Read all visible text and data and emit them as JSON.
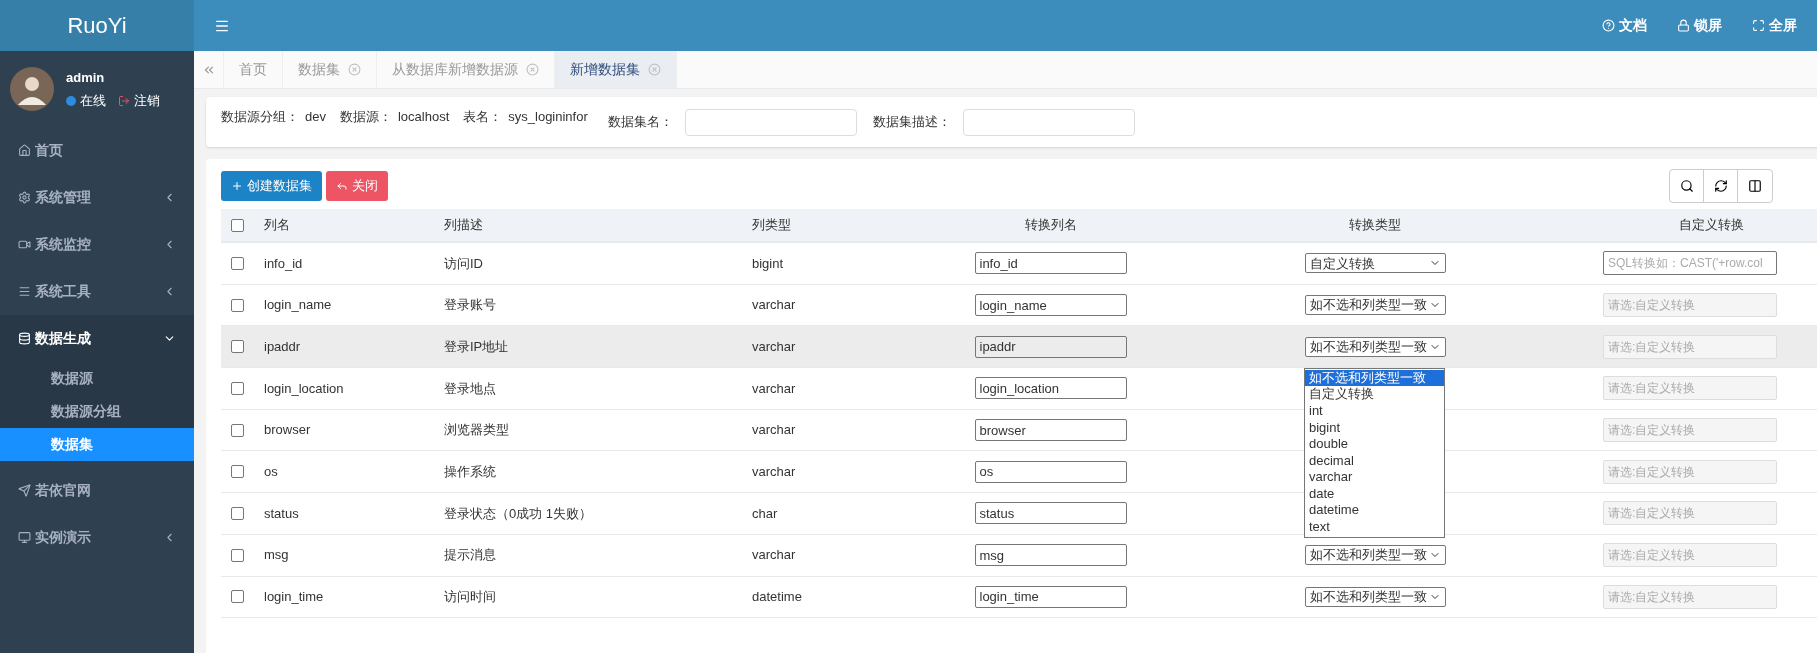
{
  "header": {
    "brand": "RuoYi",
    "actions": [
      {
        "label": "文档"
      },
      {
        "label": "锁屏"
      },
      {
        "label": "全屏"
      }
    ]
  },
  "user": {
    "name": "admin",
    "status": "在线",
    "logout": "注销"
  },
  "sidebar": {
    "items": [
      {
        "label": "首页",
        "kind": "link"
      },
      {
        "label": "系统管理",
        "kind": "group",
        "expanded": false
      },
      {
        "label": "系统监控",
        "kind": "group",
        "expanded": false
      },
      {
        "label": "系统工具",
        "kind": "group",
        "expanded": false
      },
      {
        "label": "数据生成",
        "kind": "group",
        "expanded": true,
        "children": [
          {
            "label": "数据源",
            "selected": false
          },
          {
            "label": "数据源分组",
            "selected": false
          },
          {
            "label": "数据集",
            "selected": true
          }
        ]
      },
      {
        "label": "若依官网",
        "kind": "link"
      },
      {
        "label": "实例演示",
        "kind": "group",
        "expanded": false
      }
    ]
  },
  "tabs": [
    {
      "label": "首页",
      "closable": false,
      "selected": false
    },
    {
      "label": "数据集",
      "closable": true,
      "selected": false
    },
    {
      "label": "从数据库新增数据源",
      "closable": true,
      "selected": false
    },
    {
      "label": "新增数据集",
      "closable": true,
      "selected": true
    }
  ],
  "form": {
    "info": [
      {
        "label": "数据源分组：",
        "value": "dev"
      },
      {
        "label": "数据源：",
        "value": "localhost"
      },
      {
        "label": "表名：",
        "value": "sys_logininfor"
      }
    ],
    "fields": [
      {
        "label": "数据集名："
      },
      {
        "label": "数据集描述："
      }
    ]
  },
  "buttons": [
    {
      "label": "创建数据集",
      "kind": "primary"
    },
    {
      "label": "关闭",
      "kind": "danger"
    }
  ],
  "table": {
    "select_all": false,
    "columns": [
      "列名",
      "列描述",
      "列类型",
      "转换列名",
      "转换类型",
      "自定义转换"
    ],
    "rows": [
      {
        "checked": false,
        "highlighted": false,
        "name": "info_id",
        "desc": "访问ID",
        "type": "bigint",
        "alias": "info_id",
        "convert": "自定义转换",
        "custom": {
          "placeholder": "SQL转换如：CAST('+row.col",
          "disabled": false
        }
      },
      {
        "checked": false,
        "highlighted": false,
        "name": "login_name",
        "desc": "登录账号",
        "type": "varchar",
        "alias": "login_name",
        "convert": "如不选和列类型一致",
        "custom": {
          "placeholder": "请选:自定义转换",
          "disabled": true
        }
      },
      {
        "checked": false,
        "highlighted": true,
        "name": "ipaddr",
        "desc": "登录IP地址",
        "type": "varchar",
        "alias": "ipaddr",
        "convert": "如不选和列类型一致",
        "custom": {
          "placeholder": "请选:自定义转换",
          "disabled": true
        },
        "dropdown": {
          "options": [
            {
              "label": "如不选和列类型一致",
              "selected": true
            },
            {
              "label": "自定义转换",
              "selected": false
            },
            {
              "label": "int",
              "selected": false
            },
            {
              "label": "bigint",
              "selected": false
            },
            {
              "label": "double",
              "selected": false
            },
            {
              "label": "decimal",
              "selected": false
            },
            {
              "label": "varchar",
              "selected": false
            },
            {
              "label": "date",
              "selected": false
            },
            {
              "label": "datetime",
              "selected": false
            },
            {
              "label": "text",
              "selected": false
            }
          ]
        }
      },
      {
        "checked": false,
        "highlighted": false,
        "name": "login_location",
        "desc": "登录地点",
        "type": "varchar",
        "alias": "login_location",
        "custom": {
          "placeholder": "请选:自定义转换",
          "disabled": true
        }
      },
      {
        "checked": false,
        "highlighted": false,
        "name": "browser",
        "desc": "浏览器类型",
        "type": "varchar",
        "alias": "browser",
        "custom": {
          "placeholder": "请选:自定义转换",
          "disabled": true
        }
      },
      {
        "checked": false,
        "highlighted": false,
        "name": "os",
        "desc": "操作系统",
        "type": "varchar",
        "alias": "os",
        "custom": {
          "placeholder": "请选:自定义转换",
          "disabled": true
        }
      },
      {
        "checked": false,
        "highlighted": false,
        "name": "status",
        "desc": "登录状态（0成功 1失败）",
        "type": "char",
        "alias": "status",
        "custom": {
          "placeholder": "请选:自定义转换",
          "disabled": true
        }
      },
      {
        "checked": false,
        "highlighted": false,
        "name": "msg",
        "desc": "提示消息",
        "type": "varchar",
        "alias": "msg",
        "convert": "如不选和列类型一致",
        "custom": {
          "placeholder": "请选:自定义转换",
          "disabled": true
        }
      },
      {
        "checked": false,
        "highlighted": false,
        "name": "login_time",
        "desc": "访问时间",
        "type": "datetime",
        "alias": "login_time",
        "convert": "如不选和列类型一致",
        "custom": {
          "placeholder": "请选:自定义转换",
          "disabled": true
        }
      }
    ]
  }
}
